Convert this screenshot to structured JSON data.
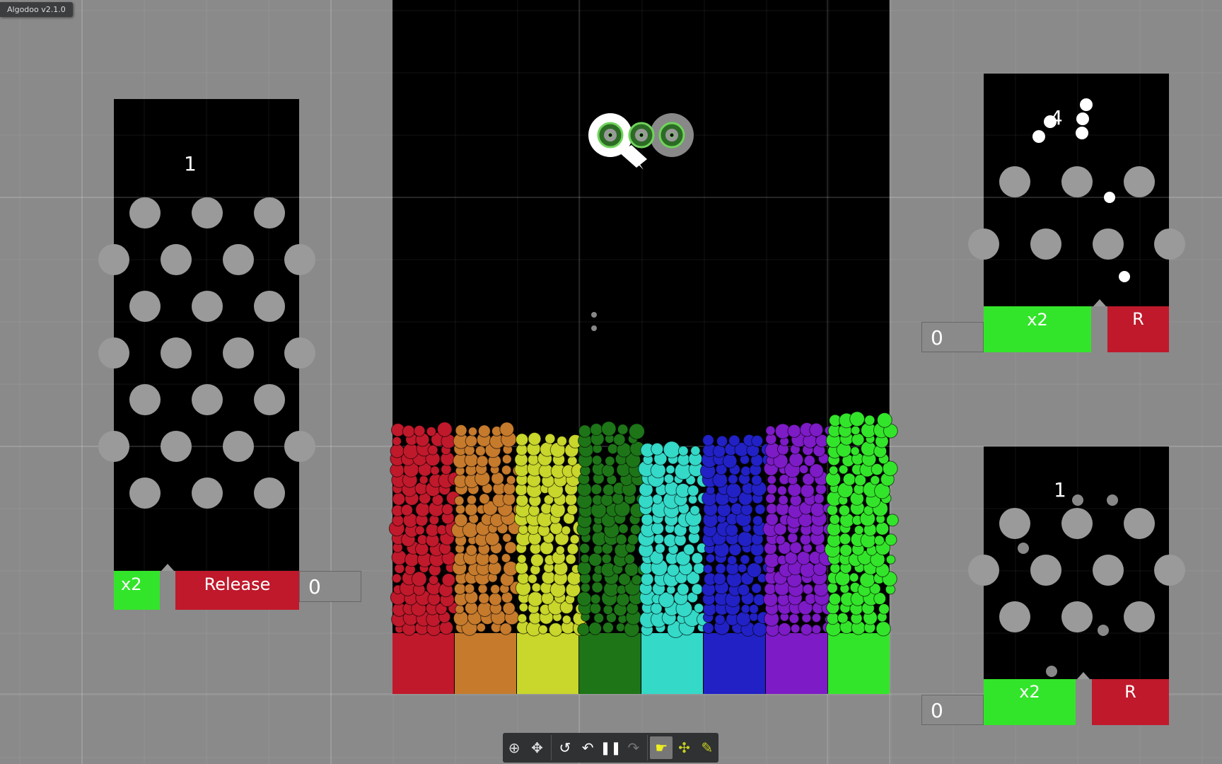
{
  "window_title": "Algodoo v2.1.0",
  "colors": {
    "bins": [
      "#c0192b",
      "#c67a2c",
      "#c9d62b",
      "#1d7518",
      "#34d9c8",
      "#2121c6",
      "#7d1bc6",
      "#33e52a"
    ],
    "button_green": "#33e52a",
    "button_red": "#c0192b"
  },
  "left_panel": {
    "counter_label": "1",
    "multiplier_label": "x2",
    "release_label": "Release",
    "count_value": "0"
  },
  "right_top_panel": {
    "counter_label": "4",
    "multiplier_label": "x2",
    "reset_label": "R",
    "count_value": "0"
  },
  "right_bottom_panel": {
    "counter_label": "1",
    "multiplier_label": "x2",
    "reset_label": "R",
    "count_value": "0"
  },
  "toolbar": {
    "items": [
      {
        "name": "zoom-icon",
        "glyph": "⊕"
      },
      {
        "name": "pan-icon",
        "glyph": "✥"
      },
      {
        "name": "reset-icon",
        "glyph": "↺"
      },
      {
        "name": "undo-icon",
        "glyph": "↶"
      },
      {
        "name": "pause-icon",
        "glyph": "❚❚"
      },
      {
        "name": "redo-icon",
        "glyph": "↷"
      },
      {
        "name": "hand-tool-icon",
        "glyph": "☛"
      },
      {
        "name": "move-tool-icon",
        "glyph": "✣"
      },
      {
        "name": "sketch-tool-icon",
        "glyph": "✎"
      }
    ]
  }
}
